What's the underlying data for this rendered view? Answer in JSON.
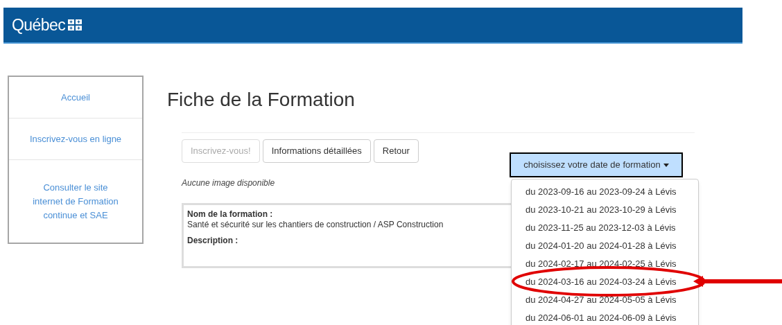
{
  "header": {
    "logo_text": "Québec"
  },
  "sidebar": {
    "items": [
      {
        "label": "Accueil"
      },
      {
        "label": "Inscrivez-vous en ligne"
      },
      {
        "label": "Consulter le site internet de Formation continue et SAE"
      }
    ]
  },
  "page": {
    "title": "Fiche de la Formation",
    "buttons": [
      {
        "label": "Inscrivez-vous!",
        "disabled": true
      },
      {
        "label": "Informations détaillées",
        "disabled": false
      },
      {
        "label": "Retour",
        "disabled": false
      }
    ],
    "image_note": "Aucune image disponible",
    "info": [
      {
        "label": "Nom de la formation :",
        "value": "Santé et sécurité sur les chantiers de construction / ASP Construction"
      },
      {
        "label": "Description :"
      }
    ]
  },
  "date_dropdown": {
    "label": "choisissez votre date de formation",
    "expanded": true,
    "options": [
      {
        "label": "du 2023-09-16 au 2023-09-24 à Lévis",
        "circled": false
      },
      {
        "label": "du 2023-10-21 au 2023-10-29 à Lévis",
        "circled": false
      },
      {
        "label": "du 2023-11-25 au 2023-12-03 à Lévis",
        "circled": false
      },
      {
        "label": "du 2024-01-20 au 2024-01-28 à Lévis",
        "circled": false
      },
      {
        "label": "du 2024-02-17 au 2024-02-25 à Lévis",
        "circled": false
      },
      {
        "label": "du 2024-03-16 au 2024-03-24 à Lévis",
        "circled": true
      },
      {
        "label": "du 2024-04-27 au 2024-05-05 à Lévis",
        "circled": false
      },
      {
        "label": "du 2024-06-01 au 2024-06-09 à Lévis",
        "circled": false
      }
    ]
  }
}
